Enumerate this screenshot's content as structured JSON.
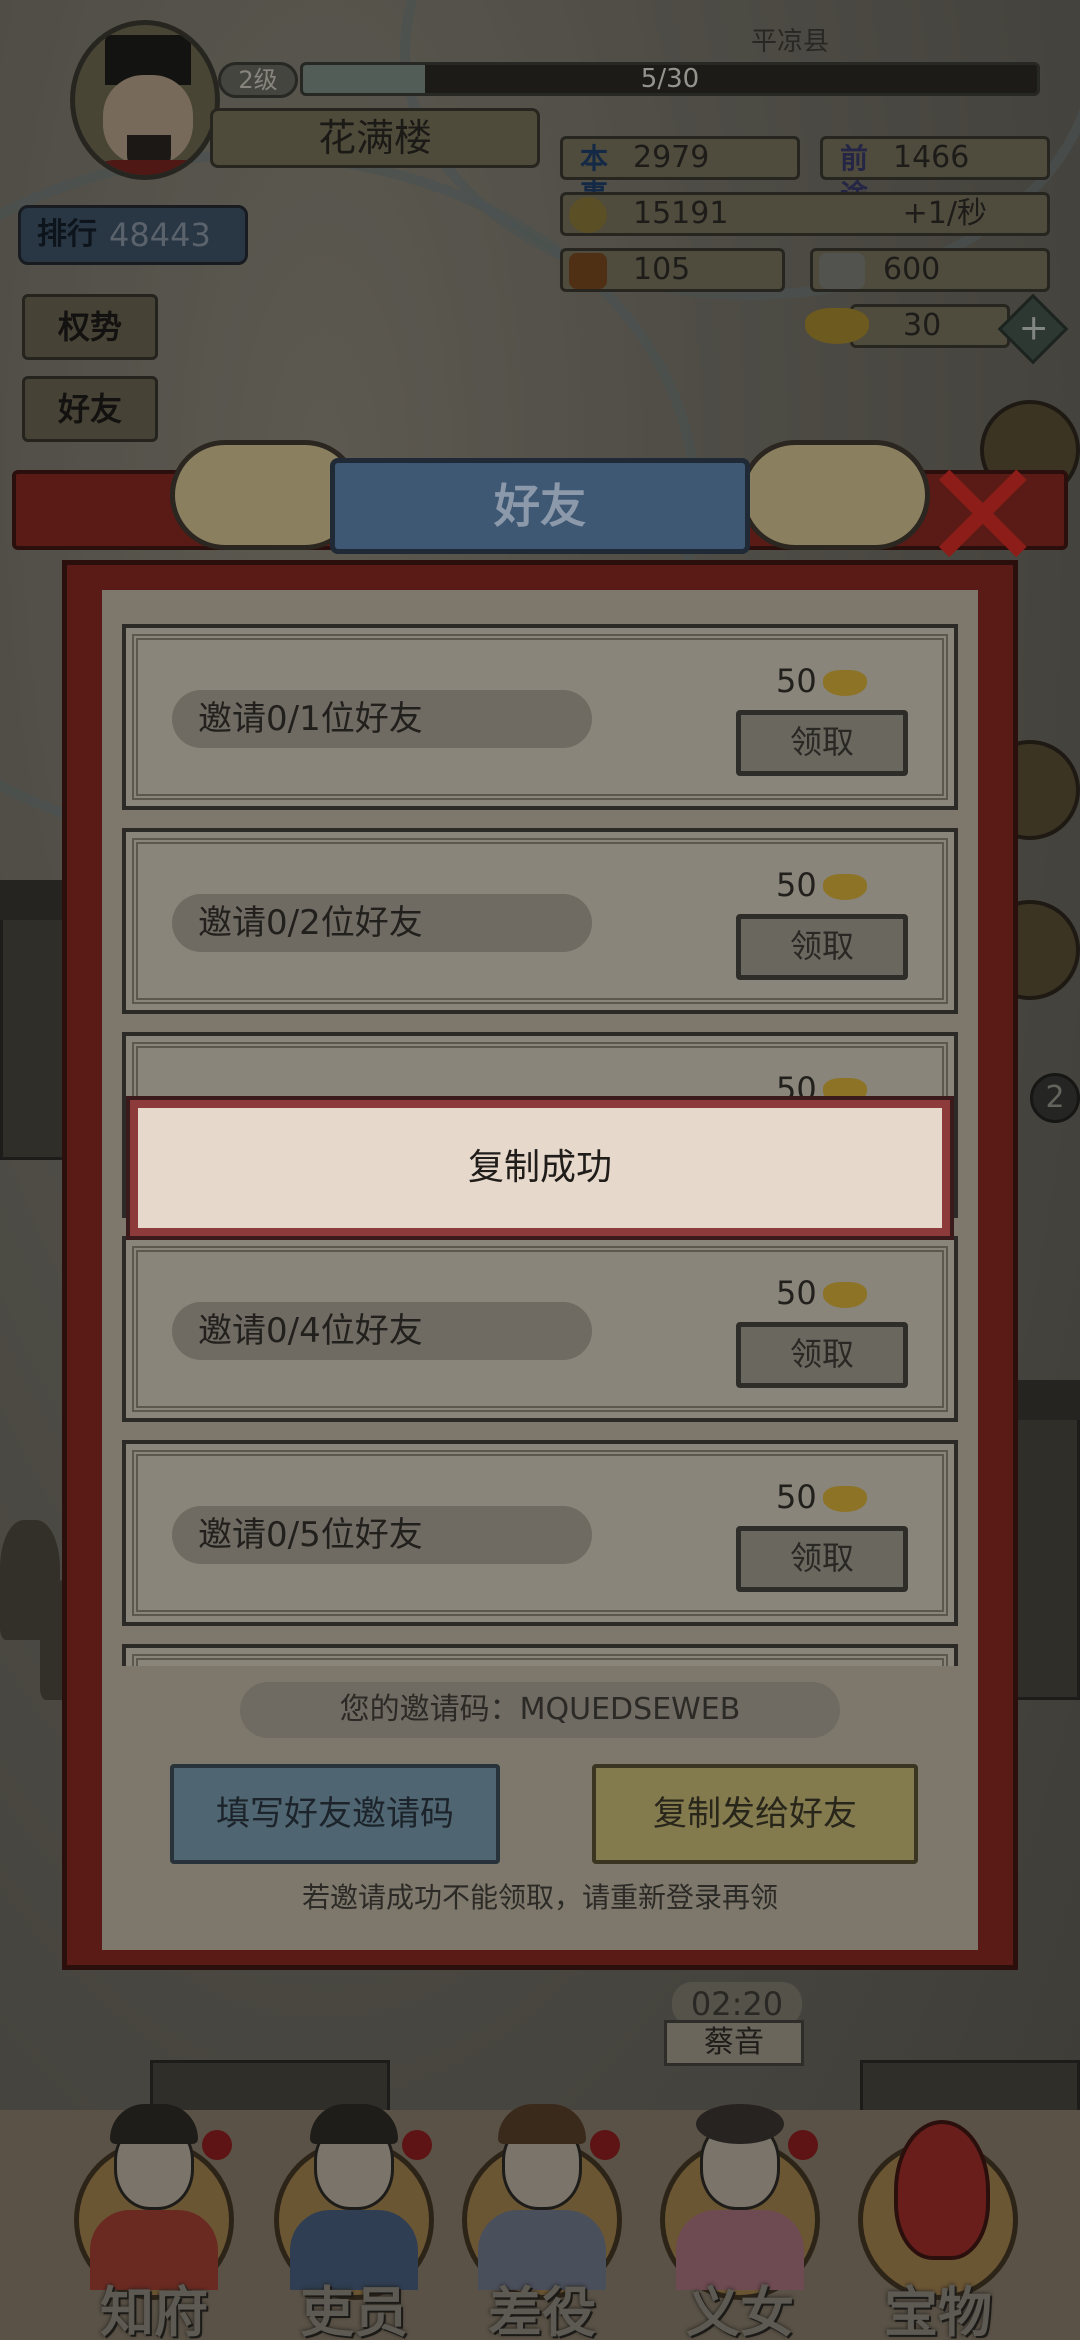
{
  "header": {
    "level": "2级",
    "xp": "5/30",
    "xp_fraction": 0.1667,
    "player_name": "花满楼",
    "county": "平凉县"
  },
  "stats": {
    "ability_label": "本事",
    "ability_value": "2979",
    "prestige_label": "前途",
    "prestige_value": "1466",
    "coins_value": "15191",
    "coins_rate": "+1/秒",
    "ticket_value": "105",
    "stone_value": "600",
    "ingot_value": "30",
    "plus_label": "+"
  },
  "sidebar": {
    "rank_label": "排行",
    "rank_value": "48443",
    "buttons": [
      "权势",
      "好友"
    ]
  },
  "right_badge": "2",
  "dialog": {
    "title": "好友",
    "close_icon": "close-x-icon",
    "rows": [
      {
        "label": "邀请0/1位好友",
        "reward": "50",
        "button": "领取"
      },
      {
        "label": "邀请0/2位好友",
        "reward": "50",
        "button": "领取"
      },
      {
        "label": "",
        "reward": "50",
        "button": ""
      },
      {
        "label": "邀请0/4位好友",
        "reward": "50",
        "button": "领取"
      },
      {
        "label": "邀请0/5位好友",
        "reward": "50",
        "button": "领取"
      }
    ],
    "invite_code_label": "您的邀请码：MQUEDSEWEB",
    "fill_button": "填写好友邀请码",
    "copy_button": "复制发给好友",
    "hint": "若邀请成功不能领取，请重新登录再领"
  },
  "toast": {
    "text": "复制成功"
  },
  "scene": {
    "timer": "02:20",
    "npc_name": "蔡音"
  },
  "bottom_tabs": [
    "知府",
    "吏员",
    "差役",
    "义女",
    "宝物"
  ]
}
